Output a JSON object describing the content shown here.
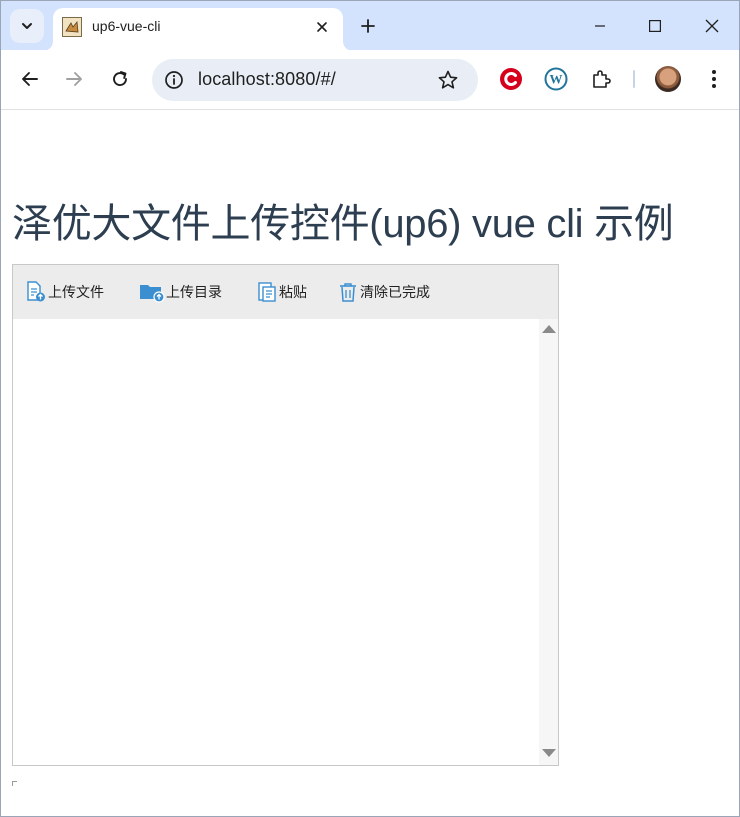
{
  "browser": {
    "tab": {
      "title": "up6-vue-cli"
    },
    "address_bar": {
      "url": "localhost:8080/#/"
    }
  },
  "page": {
    "heading": "泽优大文件上传控件(up6) vue cli 示例",
    "uploader": {
      "buttons": {
        "upload_file": "上传文件",
        "upload_folder": "上传目录",
        "paste": "粘贴",
        "clear_completed": "清除已完成"
      }
    }
  },
  "colors": {
    "tabstrip": "#d3e3fd",
    "heading_text": "#2c3e50",
    "uploader_icon_blue": "#3b8fd0",
    "extension_red": "#d6001c",
    "extension_wp": "#21759b"
  }
}
